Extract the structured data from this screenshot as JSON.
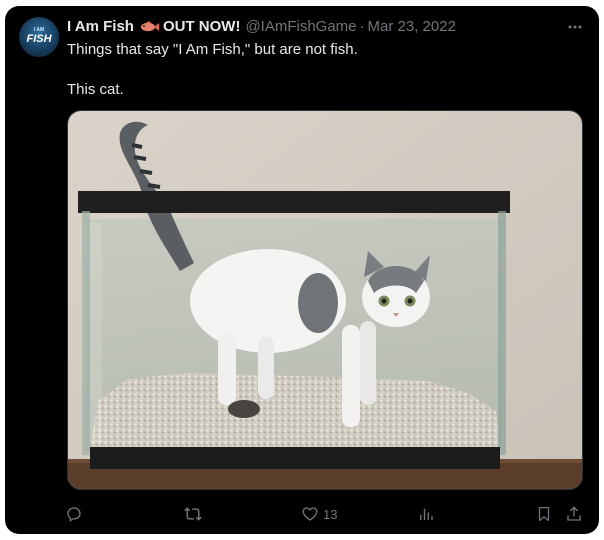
{
  "tweet": {
    "author": {
      "display_name": "I Am Fish",
      "name_emoji": "fish-emoji",
      "tagline": "OUT NOW!",
      "handle": "@IAmFishGame",
      "separator": "·",
      "date": "Mar 23, 2022",
      "avatar_text": {
        "small": "I AM",
        "big": "FISH"
      }
    },
    "text_lines": [
      "Things that say \"I Am Fish,\" but are not fish.",
      "This cat."
    ],
    "media": {
      "subject": "photo-cat-in-aquarium"
    },
    "actions": {
      "reply": {
        "icon": "reply-icon"
      },
      "retweet": {
        "icon": "retweet-icon"
      },
      "like": {
        "icon": "heart-icon",
        "count": "13"
      },
      "views": {
        "icon": "views-icon"
      },
      "bookmark": {
        "icon": "bookmark-icon"
      },
      "share": {
        "icon": "share-icon"
      }
    }
  },
  "colors": {
    "background": "#000000",
    "text_primary": "#e7e9ea",
    "text_secondary": "#71767b",
    "border": "#2f3336"
  }
}
